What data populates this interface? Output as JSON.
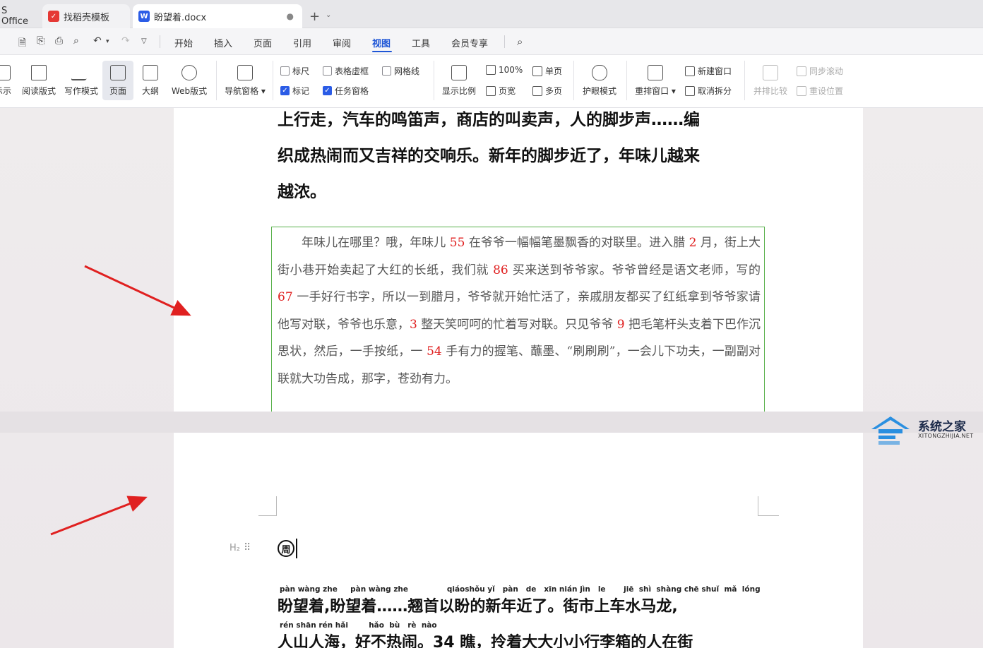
{
  "tabs": [
    {
      "label": "S Office"
    },
    {
      "label": "找稻壳模板",
      "icon": "daoke-icon"
    },
    {
      "label": "盼望着.docx",
      "icon": "wps-writer-icon",
      "modified_dot": "●"
    }
  ],
  "tab_add": "+",
  "tab_more": "⌄",
  "menu": [
    "开始",
    "插入",
    "页面",
    "引用",
    "审阅",
    "视图",
    "工具",
    "会员专享"
  ],
  "menu_active": "视图",
  "ribbon": {
    "buttons": [
      "示示",
      "阅读版式",
      "写作模式",
      "页面",
      "大纲",
      "Web版式",
      "导航窗格",
      "显示比例",
      "护眼模式",
      "重排窗口",
      "并排比较"
    ],
    "checks": [
      {
        "label": "标尺",
        "checked": false
      },
      {
        "label": "表格虚框",
        "checked": false
      },
      {
        "label": "网格线",
        "checked": false
      },
      {
        "label": "标记",
        "checked": true
      },
      {
        "label": "任务窗格",
        "checked": true
      }
    ],
    "zoom": {
      "percent": "100%",
      "page_width": "页宽",
      "single": "单页",
      "multi": "多页"
    },
    "window": {
      "new": "新建窗口",
      "cancel_split": "取消拆分",
      "sync_scroll": "同步滚动",
      "reset_pos": "重设位置"
    }
  },
  "doc": {
    "page1_heading_lines": [
      "上行走，汽车的鸣笛声，商店的叫卖声，人的脚步声……编",
      "织成热闹而又吉祥的交响乐。新年的脚步近了，年味儿越来",
      "越浓。"
    ],
    "para_segments": [
      {
        "t": "　　年味儿在哪里？哦，年味儿 "
      },
      {
        "t": "55",
        "num": true
      },
      {
        "t": " 在爷爷一幅幅笔墨飘香的对联里。进入腊 "
      },
      {
        "t": "2",
        "num": true
      },
      {
        "t": " 月，街上大街小巷开始卖起了大红的长纸，我们就 "
      },
      {
        "t": "86",
        "num": true
      },
      {
        "t": " 买来送到爷爷家。爷爷曾经是语文老师，写的 "
      },
      {
        "t": "67",
        "num": true
      },
      {
        "t": " 一手好行书字，所以一到腊月，爷爷就开始忙活了，亲戚朋友都买了红纸拿到爷爷家请他写对联，爷爷也乐意，"
      },
      {
        "t": "3",
        "num": true
      },
      {
        "t": " 整天笑呵呵的忙着写对联。只见爷爷 "
      },
      {
        "t": "9",
        "num": true
      },
      {
        "t": " 把毛笔杆头支着下巴作沉思状，然后，一手按纸，一 "
      },
      {
        "t": "54",
        "num": true
      },
      {
        "t": " 手有力的握笔、蘸墨、“刷刷刷”，一会儿下功夫，一副副对联就大功告成，那字，苍劲有力。"
      }
    ],
    "h2_marker": "H₂",
    "drag_handle": "⠿",
    "title_char": "周",
    "pinyin_line1": "pàn wàng zhe     pàn wàng zhe               qiáoshǒu yǐ   pàn   de   xīn nián jìn   le       jiē  shì  shàng chē shuǐ  mǎ  lóng",
    "han_line1": "盼望着,盼望着……翘首以盼的新年近了。街市上车水马龙,",
    "pinyin_line2": "rén shān rén hǎi        hǎo  bù   rè  nào",
    "han_line2": "人山人海，好不热闹。34 瞧，拎着大大小小行李箱的人在街"
  },
  "watermark": {
    "name": "系统之家",
    "url": "XITONGZHIJIA.NET"
  },
  "colors": {
    "accent": "#1f56d6",
    "comment_border": "#58b04a",
    "number_red": "#e02020",
    "arrow_red": "#e02020"
  }
}
